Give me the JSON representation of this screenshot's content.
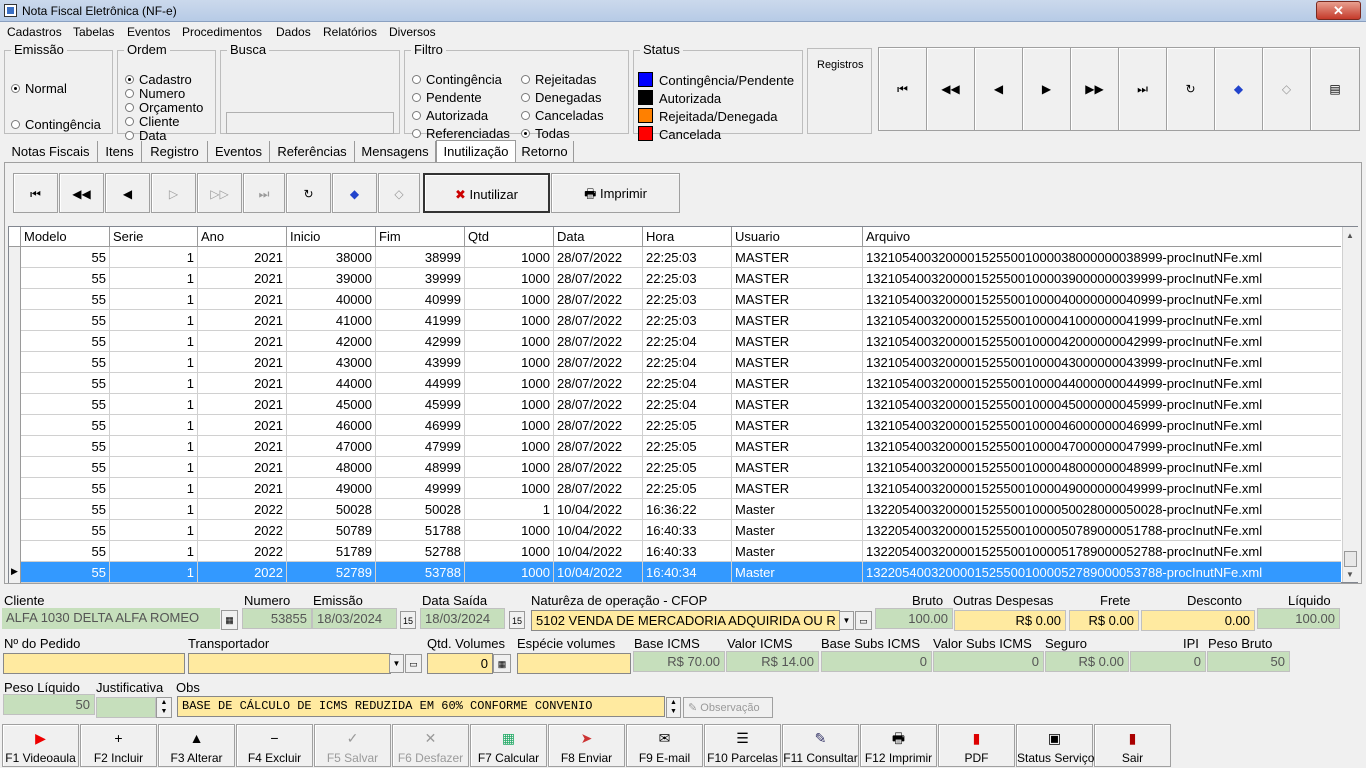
{
  "window": {
    "title": "Nota Fiscal Eletrônica (NF-e)",
    "close": "✕"
  },
  "menu": [
    "Cadastros",
    "Tabelas",
    "Eventos",
    "Procedimentos",
    "Dados",
    "Relatórios",
    "Diversos"
  ],
  "emissao": {
    "title": "Emissão",
    "options": [
      "Normal",
      "Contingência"
    ],
    "selected": "Normal"
  },
  "ordem": {
    "title": "Ordem",
    "options": [
      "Cadastro",
      "Numero",
      "Orçamento",
      "Cliente",
      "Data"
    ],
    "selected": "Cadastro"
  },
  "busca": {
    "title": "Busca",
    "value": ""
  },
  "filtro": {
    "title": "Filtro",
    "options": [
      "Contingência",
      "Pendente",
      "Autorizada",
      "Referenciadas",
      "Rejeitadas",
      "Denegadas",
      "Canceladas",
      "Todas"
    ],
    "selected": "Todas"
  },
  "status": {
    "title": "Status",
    "items": [
      {
        "label": "Contingência/Pendente",
        "color": "#0000ff"
      },
      {
        "label": "Autorizada",
        "color": "#000000"
      },
      {
        "label": "Rejeitada/Denegada",
        "color": "#ff8000"
      },
      {
        "label": "Cancelada",
        "color": "#ff0000"
      }
    ]
  },
  "registros": "Registros",
  "nav_icons": [
    "first-icon",
    "prior-page-icon",
    "prior-icon",
    "next-icon",
    "next-page-icon",
    "last-icon",
    "refresh-icon",
    "bookmark-icon",
    "goto-icon",
    "report-icon"
  ],
  "tabs": [
    "Notas Fiscais",
    "Itens",
    "Registro",
    "Eventos",
    "Referências",
    "Mensagens",
    "Inutilização",
    "Retorno"
  ],
  "active_tab": "Inutilização",
  "toolbar": {
    "inutilizar": "Inutilizar",
    "imprimir": "Imprimir"
  },
  "grid": {
    "columns": [
      "Modelo",
      "Serie",
      "Ano",
      "Inicio",
      "Fim",
      "Qtd",
      "Data",
      "Hora",
      "Usuario",
      "Arquivo"
    ],
    "rows": [
      [
        "55",
        "1",
        "2021",
        "38000",
        "38999",
        "1000",
        "28/07/2022",
        "22:25:03",
        "MASTER",
        "13210540032000015255001000038000000038999-procInutNFe.xml"
      ],
      [
        "55",
        "1",
        "2021",
        "39000",
        "39999",
        "1000",
        "28/07/2022",
        "22:25:03",
        "MASTER",
        "13210540032000015255001000039000000039999-procInutNFe.xml"
      ],
      [
        "55",
        "1",
        "2021",
        "40000",
        "40999",
        "1000",
        "28/07/2022",
        "22:25:03",
        "MASTER",
        "13210540032000015255001000040000000040999-procInutNFe.xml"
      ],
      [
        "55",
        "1",
        "2021",
        "41000",
        "41999",
        "1000",
        "28/07/2022",
        "22:25:03",
        "MASTER",
        "13210540032000015255001000041000000041999-procInutNFe.xml"
      ],
      [
        "55",
        "1",
        "2021",
        "42000",
        "42999",
        "1000",
        "28/07/2022",
        "22:25:04",
        "MASTER",
        "13210540032000015255001000042000000042999-procInutNFe.xml"
      ],
      [
        "55",
        "1",
        "2021",
        "43000",
        "43999",
        "1000",
        "28/07/2022",
        "22:25:04",
        "MASTER",
        "13210540032000015255001000043000000043999-procInutNFe.xml"
      ],
      [
        "55",
        "1",
        "2021",
        "44000",
        "44999",
        "1000",
        "28/07/2022",
        "22:25:04",
        "MASTER",
        "13210540032000015255001000044000000044999-procInutNFe.xml"
      ],
      [
        "55",
        "1",
        "2021",
        "45000",
        "45999",
        "1000",
        "28/07/2022",
        "22:25:04",
        "MASTER",
        "13210540032000015255001000045000000045999-procInutNFe.xml"
      ],
      [
        "55",
        "1",
        "2021",
        "46000",
        "46999",
        "1000",
        "28/07/2022",
        "22:25:05",
        "MASTER",
        "13210540032000015255001000046000000046999-procInutNFe.xml"
      ],
      [
        "55",
        "1",
        "2021",
        "47000",
        "47999",
        "1000",
        "28/07/2022",
        "22:25:05",
        "MASTER",
        "13210540032000015255001000047000000047999-procInutNFe.xml"
      ],
      [
        "55",
        "1",
        "2021",
        "48000",
        "48999",
        "1000",
        "28/07/2022",
        "22:25:05",
        "MASTER",
        "13210540032000015255001000048000000048999-procInutNFe.xml"
      ],
      [
        "55",
        "1",
        "2021",
        "49000",
        "49999",
        "1000",
        "28/07/2022",
        "22:25:05",
        "MASTER",
        "13210540032000015255001000049000000049999-procInutNFe.xml"
      ],
      [
        "55",
        "1",
        "2022",
        "50028",
        "50028",
        "1",
        "10/04/2022",
        "16:36:22",
        "Master",
        "13220540032000015255001000050028000050028-procInutNFe.xml"
      ],
      [
        "55",
        "1",
        "2022",
        "50789",
        "51788",
        "1000",
        "10/04/2022",
        "16:40:33",
        "Master",
        "13220540032000015255001000050789000051788-procInutNFe.xml"
      ],
      [
        "55",
        "1",
        "2022",
        "51789",
        "52788",
        "1000",
        "10/04/2022",
        "16:40:33",
        "Master",
        "13220540032000015255001000051789000052788-procInutNFe.xml"
      ],
      [
        "55",
        "1",
        "2022",
        "52789",
        "53788",
        "1000",
        "10/04/2022",
        "16:40:34",
        "Master",
        "13220540032000015255001000052789000053788-procInutNFe.xml"
      ]
    ],
    "selected_row": 15
  },
  "form": {
    "cliente_label": "Cliente",
    "cliente": "ALFA 1030 DELTA ALFA ROMEO",
    "numero_label": "Numero",
    "numero": "53855",
    "emissao_label": "Emissão",
    "emissao": "18/03/2024",
    "saida_label": "Data Saída",
    "saida": "18/03/2024",
    "cfop_label": "Naturêza de operação - CFOP",
    "cfop": "5102 VENDA DE MERCADORIA ADQUIRIDA OU R",
    "bruto_label": "Bruto",
    "bruto": "100.00",
    "outras_label": "Outras Despesas",
    "outras": "R$ 0.00",
    "frete_label": "Frete",
    "frete": "R$ 0.00",
    "desconto_label": "Desconto",
    "desconto": "0.00",
    "liquido_label": "Líquido",
    "liquido": "100.00",
    "pedido_label": "Nº do Pedido",
    "pedido": "",
    "transp_label": "Transportador",
    "transp": "",
    "qtdvol_label": "Qtd. Volumes",
    "qtdvol": "0",
    "especie_label": "Espécie volumes",
    "especie": "",
    "baseicms_label": "Base ICMS",
    "baseicms": "R$ 70.00",
    "valoricms_label": "Valor ICMS",
    "valoricms": "R$ 14.00",
    "basesubs_label": "Base Subs ICMS",
    "basesubs": "0",
    "valorsubs_label": "Valor Subs ICMS",
    "valorsubs": "0",
    "seguro_label": "Seguro",
    "seguro": "R$ 0.00",
    "ipi_label": "IPI",
    "ipi": "0",
    "pesobruto_label": "Peso Bruto",
    "pesobruto": "50",
    "pesoliq_label": "Peso Líquido",
    "pesoliq": "50",
    "justif_label": "Justificativa",
    "justif": "",
    "obs_label": "Obs",
    "obs": "BASE DE CÁLCULO DE ICMS REDUZIDA EM  60%  CONFORME  CONVENIO",
    "observacao_btn": "Observação"
  },
  "footer": [
    {
      "label": "F1 Videoaula",
      "icon": "youtube-icon"
    },
    {
      "label": "F2 Incluir",
      "icon": "plus-icon"
    },
    {
      "label": "F3 Alterar",
      "icon": "up-arrow-icon"
    },
    {
      "label": "F4 Excluir",
      "icon": "minus-icon"
    },
    {
      "label": "F5 Salvar",
      "icon": "check-icon"
    },
    {
      "label": "F6 Desfazer",
      "icon": "x-icon"
    },
    {
      "label": "F7 Calcular",
      "icon": "calculator-icon"
    },
    {
      "label": "F8 Enviar",
      "icon": "send-icon"
    },
    {
      "label": "F9 E-mail",
      "icon": "mail-icon"
    },
    {
      "label": "F10 Parcelas",
      "icon": "list-icon"
    },
    {
      "label": "F11 Consultar",
      "icon": "search-doc-icon"
    },
    {
      "label": "F12 Imprimir",
      "icon": "printer-icon"
    },
    {
      "label": "PDF",
      "icon": "pdf-icon"
    },
    {
      "label": "Status Serviço",
      "icon": "server-icon"
    },
    {
      "label": "Sair",
      "icon": "exit-icon"
    }
  ]
}
